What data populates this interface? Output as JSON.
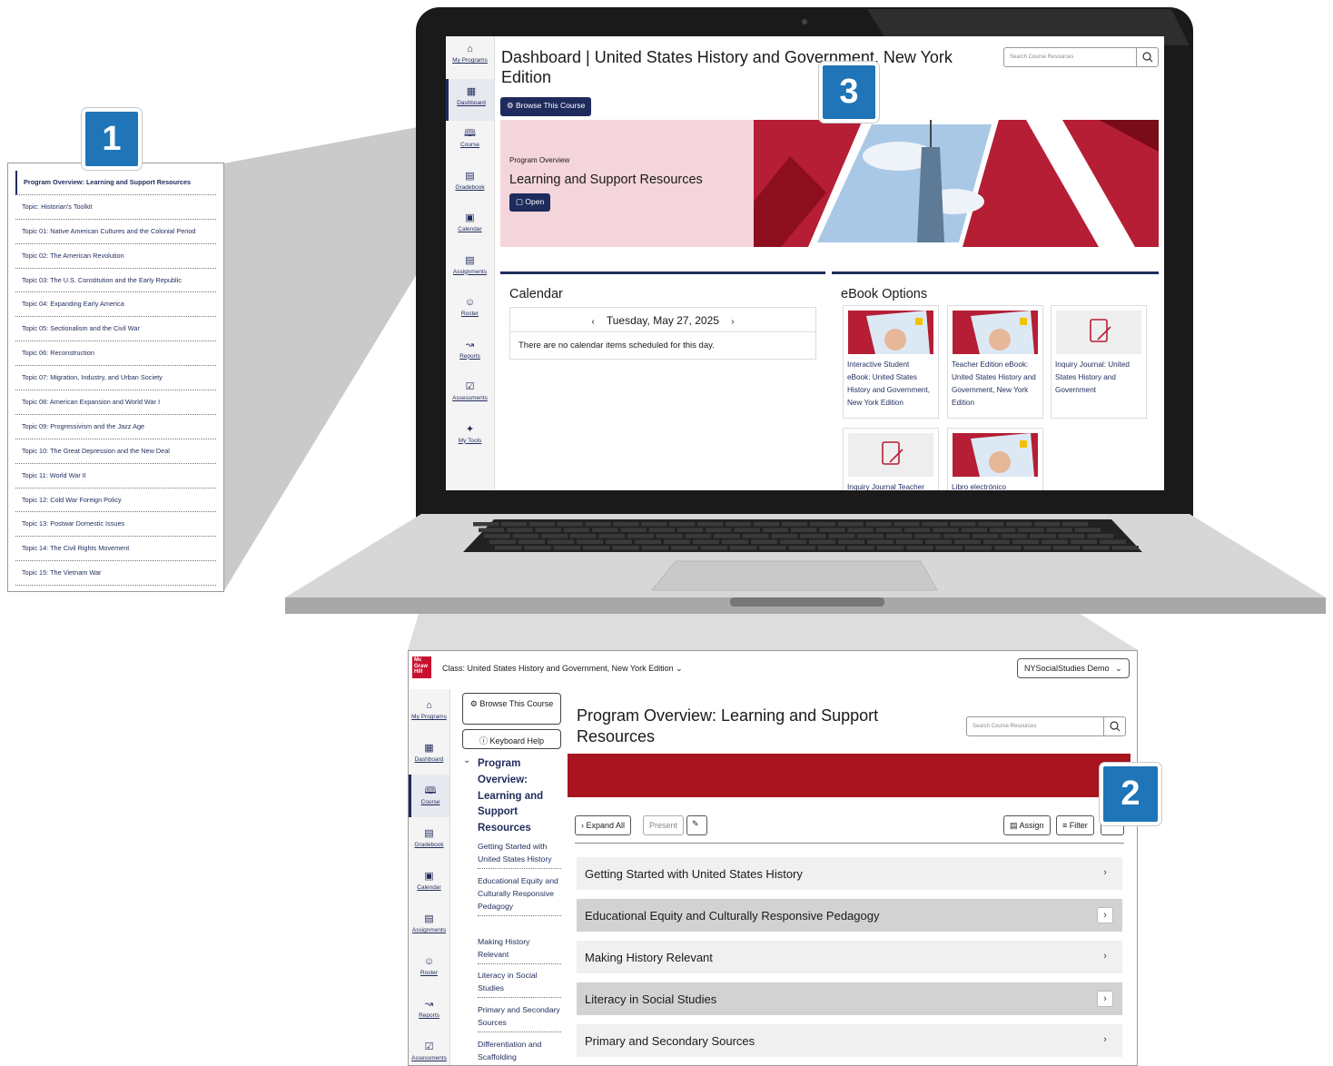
{
  "topic_panel": {
    "items": [
      "Program Overview: Learning and Support Resources",
      "Topic: Historian's Toolkit",
      "Topic 01: Native American Cultures and the Colonial Period",
      "Topic 02: The American Revolution",
      "Topic 03: The U.S. Constitution and the Early Republic",
      "Topic 04: Expanding Early America",
      "Topic 05: Sectionalism and the Civil War",
      "Topic 06: Reconstruction",
      "Topic 07: Migration, Industry, and Urban Society",
      "Topic 08: American Expansion and World War I",
      "Topic 09: Progressivism and the Jazz Age",
      "Topic 10: The Great Depression and the New Deal",
      "Topic 11: World War II",
      "Topic 12: Cold War Foreign Policy",
      "Topic 13: Postwar Domestic Issues",
      "Topic 14: The Civil Rights Movement",
      "Topic 15: The Vietnam War"
    ]
  },
  "badges": {
    "one": "1",
    "two": "2",
    "three": "3"
  },
  "nav": {
    "items": [
      "My Programs",
      "Dashboard",
      "Course",
      "Gradebook",
      "Calendar",
      "Assignments",
      "Roster",
      "Reports",
      "Assessments",
      "My Tools"
    ]
  },
  "dashboard": {
    "title": "Dashboard | United States History and Government, New York Edition",
    "search_placeholder": "Search Course Resources",
    "browse_label": "Browse This Course",
    "hero_eyebrow": "Program Overview",
    "hero_title": "Learning and Support Resources",
    "open_label": "Open",
    "calendar": {
      "title": "Calendar",
      "date": "Tuesday, May 27, 2025",
      "empty": "There are no calendar items scheduled for this day."
    },
    "ebook": {
      "title": "eBook Options",
      "tiles": [
        "Interactive Student eBook: United States History and Government, New York Edition",
        "Teacher Edition eBook: United States History and Government, New York Edition",
        "Inquiry Journal: United States History and Government",
        "Inquiry Journal Teacher",
        "Libro electrónico"
      ]
    }
  },
  "course": {
    "logo": "Mc Graw Hill",
    "class_label": "Class: United States History and Government, New York Edition",
    "user_label": "NYSocialStudies Demo",
    "browse_label": "Browse This Course",
    "keyboard_label": "Keyboard Help",
    "toc_heading": "Program Overview: Learning and Support Resources",
    "toc_items": [
      "Getting Started with United States History",
      "Educational Equity and Culturally Responsive Pedagogy",
      "Making History Relevant",
      "Literacy in Social Studies",
      "Primary and Secondary Sources",
      "Differentiation and Scaffolding"
    ],
    "title": "Program Overview: Learning and Support Resources",
    "search_placeholder": "Search Course Resources",
    "toolbar": {
      "expand": "Expand All",
      "present": "Present",
      "assign": "Assign",
      "filter": "Filter"
    },
    "accordion": [
      "Getting Started with United States History",
      "Educational Equity and Culturally Responsive Pedagogy",
      "Making History Relevant",
      "Literacy in Social Studies",
      "Primary and Secondary Sources"
    ]
  },
  "colors": {
    "navy": "#1f2b5c",
    "badge_blue": "#1f75b8",
    "brand_red": "#c8102e",
    "banner_red": "#a8151f",
    "hero_pink": "#f5d5dc"
  }
}
